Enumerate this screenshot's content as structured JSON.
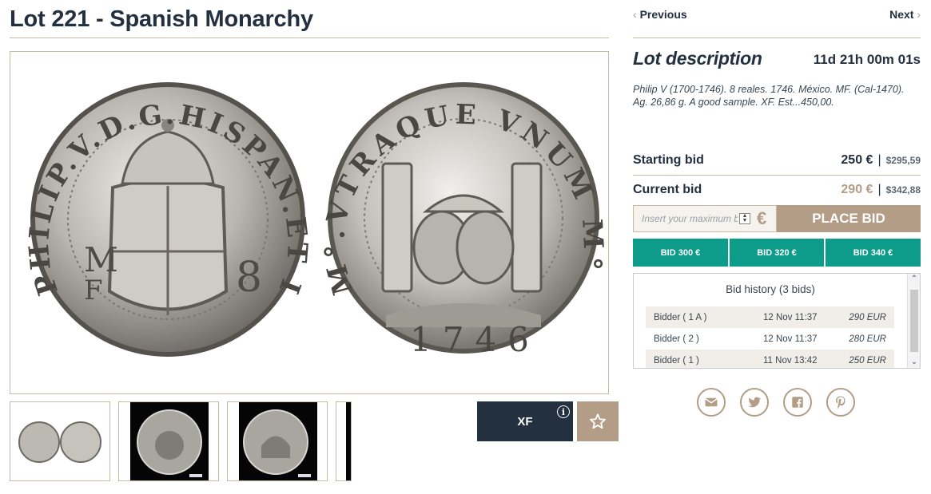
{
  "lot": {
    "title": "Lot 221 - Spanish Monarchy"
  },
  "nav": {
    "previous": "Previous",
    "next": "Next"
  },
  "description": {
    "heading": "Lot description",
    "countdown": "11d 21h 00m 01s",
    "text": "Philip V (1700-1746). 8 reales. 1746. México. MF. (Cal-1470). Ag. 26,86 g. A good sample. XF. Est...450,00."
  },
  "bids": {
    "starting_label": "Starting bid",
    "starting_amount": "250 €",
    "starting_converted": "$295,59",
    "current_label": "Current bid",
    "current_amount": "290 €",
    "current_converted": "$342,88",
    "separator": "|",
    "input_placeholder": "Insert your maximum bid",
    "currency_symbol": "€",
    "place_bid_label": "PLACE BID",
    "quick_bids": [
      "BID 300 €",
      "BID 320 €",
      "BID 340 €"
    ]
  },
  "history": {
    "title": "Bid history (3 bids)",
    "rows": [
      {
        "bidder": "Bidder ( 1 A )",
        "time": "12 Nov 11:37",
        "amount": "290 EUR"
      },
      {
        "bidder": "Bidder ( 2 )",
        "time": "12 Nov 11:37",
        "amount": "280 EUR"
      },
      {
        "bidder": "Bidder ( 1 )",
        "time": "11 Nov 13:42",
        "amount": "250 EUR"
      }
    ]
  },
  "grade": {
    "label": "XF",
    "info_icon": "i"
  },
  "icons": {
    "favorite": "star-icon",
    "social": [
      "mail-icon",
      "twitter-icon",
      "facebook-icon",
      "pinterest-icon"
    ]
  },
  "colors": {
    "navy": "#22303f",
    "tan": "#b39d86",
    "teal": "#0e9c8a",
    "rule": "#c8b9a4"
  }
}
